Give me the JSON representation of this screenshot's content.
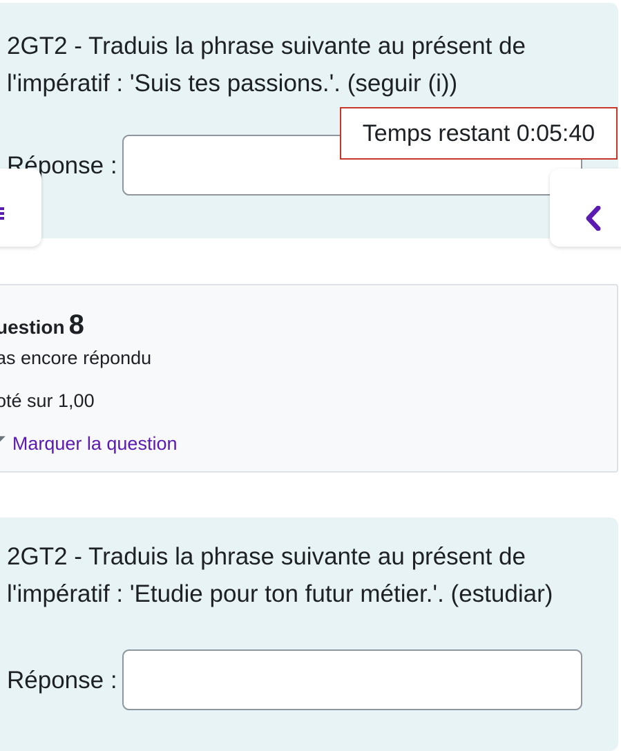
{
  "q7": {
    "text_line1": "2GT2 - Traduis la phrase suivante au présent de",
    "text_line2": "l'impératif : 'Suis tes passions.'. (seguir (i))",
    "answer_label": "Réponse :",
    "answer_value": ""
  },
  "timer": {
    "text": "Temps restant 0:05:40"
  },
  "nav": {
    "drawer_icon": "hamburger-icon",
    "right_icon": "chevron-left-icon"
  },
  "q8_info": {
    "label": "uestion",
    "number": "8",
    "state": "as encore répondu",
    "grade": "oté sur 1,00",
    "flag_label": "Marquer la question",
    "flag_icon": "flag-icon"
  },
  "q8": {
    "text_line1": "2GT2 - Traduis la phrase suivante au présent de",
    "text_line2": "l'impératif : 'Etudie pour ton futur métier.'. (estudiar)",
    "answer_label": "Réponse :",
    "answer_value": ""
  },
  "colors": {
    "formulation_bg": "#e7f3f5",
    "accent": "#5b1ab2",
    "timer_border": "#c8362a",
    "info_bg": "#f8f9fa"
  }
}
